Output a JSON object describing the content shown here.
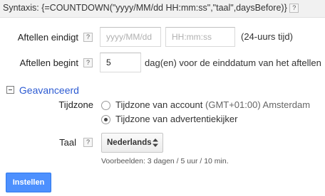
{
  "syntax": {
    "label": "Syntaxis:",
    "formula": "{=COUNTDOWN(\"yyyy/MM/dd HH:mm:ss\",\"taal\",daysBefore)}",
    "help": "?"
  },
  "end_row": {
    "label": "Aftellen eindigt",
    "help": "?",
    "date_placeholder": "yyyy/MM/dd",
    "time_placeholder": "HH:mm:ss",
    "suffix": "(24-uurs tijd)"
  },
  "start_row": {
    "label": "Aftellen begint",
    "help": "?",
    "value": "5",
    "suffix": "dag(en) voor de einddatum van het aftellen"
  },
  "advanced": {
    "title": "Geavanceerd",
    "timezone": {
      "label": "Tijdzone",
      "options": [
        {
          "label": "Tijdzone van account",
          "detail": "(GMT+01:00) Amsterdam",
          "checked": false
        },
        {
          "label": "Tijdzone van advertentiekijker",
          "detail": "",
          "checked": true
        }
      ]
    },
    "language": {
      "label": "Taal",
      "help": "?",
      "selected": "Nederlands",
      "note": "Voorbeelden: 3 dagen / 5 uur / 10 min."
    }
  },
  "actions": {
    "submit_label": "Instellen"
  },
  "colors": {
    "link": "#2d5bd2",
    "primary_button": "#4d90fe"
  }
}
